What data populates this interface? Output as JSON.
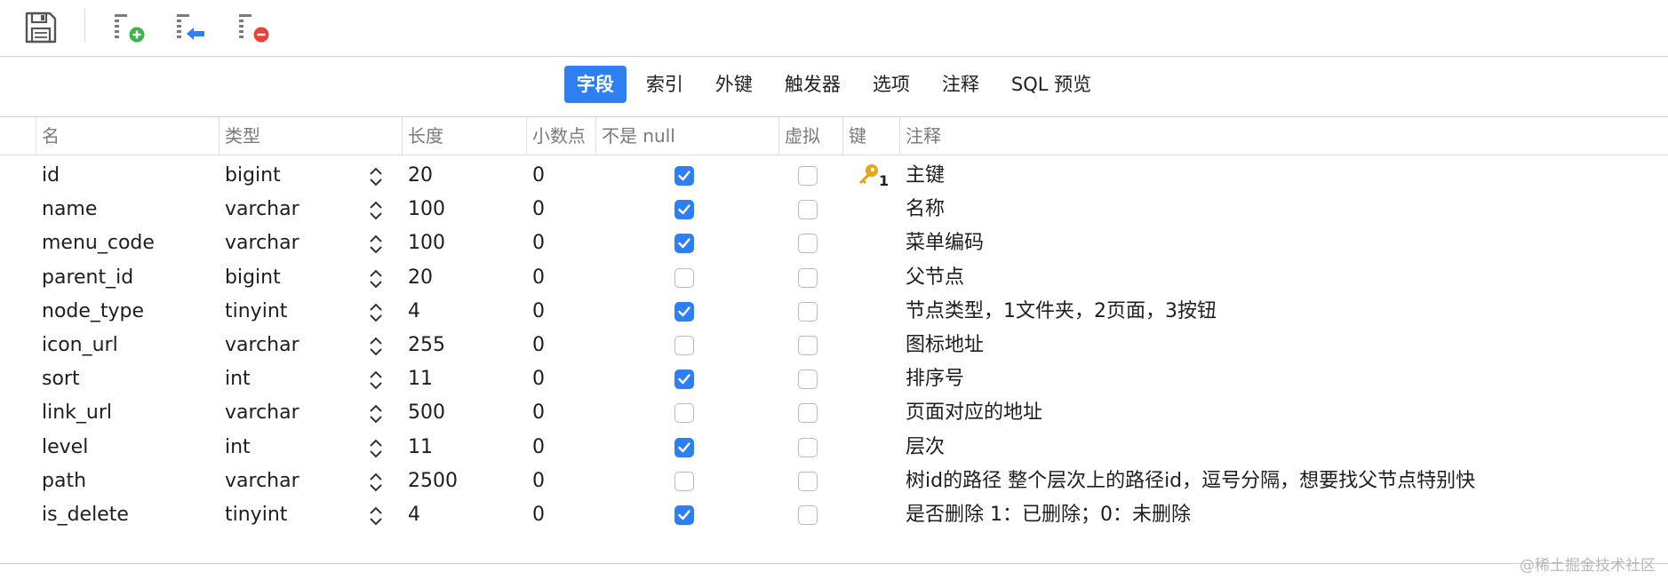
{
  "toolbar": {
    "buttons": [
      {
        "name": "save",
        "icon": "floppy-disk-icon"
      },
      {
        "name": "add-field",
        "icon": "add-field-icon"
      },
      {
        "name": "insert-field",
        "icon": "insert-field-icon"
      },
      {
        "name": "delete-field",
        "icon": "delete-field-icon"
      }
    ]
  },
  "tabs": [
    {
      "label": "字段",
      "active": true
    },
    {
      "label": "索引",
      "active": false
    },
    {
      "label": "外键",
      "active": false
    },
    {
      "label": "触发器",
      "active": false
    },
    {
      "label": "选项",
      "active": false
    },
    {
      "label": "注释",
      "active": false
    },
    {
      "label": "SQL 预览",
      "active": false
    }
  ],
  "columns": [
    "名",
    "类型",
    "长度",
    "小数点",
    "不是 null",
    "虚拟",
    "键",
    "注释"
  ],
  "rows": [
    {
      "name": "id",
      "type": "bigint",
      "length": "20",
      "decimals": "0",
      "not_null": true,
      "virtual": false,
      "key": "1",
      "comment": "主键"
    },
    {
      "name": "name",
      "type": "varchar",
      "length": "100",
      "decimals": "0",
      "not_null": true,
      "virtual": false,
      "key": "",
      "comment": "名称"
    },
    {
      "name": "menu_code",
      "type": "varchar",
      "length": "100",
      "decimals": "0",
      "not_null": true,
      "virtual": false,
      "key": "",
      "comment": "菜单编码"
    },
    {
      "name": "parent_id",
      "type": "bigint",
      "length": "20",
      "decimals": "0",
      "not_null": false,
      "virtual": false,
      "key": "",
      "comment": "父节点"
    },
    {
      "name": "node_type",
      "type": "tinyint",
      "length": "4",
      "decimals": "0",
      "not_null": true,
      "virtual": false,
      "key": "",
      "comment": "节点类型，1文件夹，2页面，3按钮"
    },
    {
      "name": "icon_url",
      "type": "varchar",
      "length": "255",
      "decimals": "0",
      "not_null": false,
      "virtual": false,
      "key": "",
      "comment": "图标地址"
    },
    {
      "name": "sort",
      "type": "int",
      "length": "11",
      "decimals": "0",
      "not_null": true,
      "virtual": false,
      "key": "",
      "comment": "排序号"
    },
    {
      "name": "link_url",
      "type": "varchar",
      "length": "500",
      "decimals": "0",
      "not_null": false,
      "virtual": false,
      "key": "",
      "comment": "页面对应的地址"
    },
    {
      "name": "level",
      "type": "int",
      "length": "11",
      "decimals": "0",
      "not_null": true,
      "virtual": false,
      "key": "",
      "comment": "层次"
    },
    {
      "name": "path",
      "type": "varchar",
      "length": "2500",
      "decimals": "0",
      "not_null": false,
      "virtual": false,
      "key": "",
      "comment": "树id的路径 整个层次上的路径id，逗号分隔，想要找父节点特别快"
    },
    {
      "name": "is_delete",
      "type": "tinyint",
      "length": "4",
      "decimals": "0",
      "not_null": true,
      "virtual": false,
      "key": "",
      "comment": "是否删除 1：已删除；0：未删除"
    }
  ],
  "watermark": "@稀土掘金技术社区",
  "colors": {
    "accent": "#2d7ff2",
    "key_icon": "#e8a317",
    "add_icon": "#3ab54a",
    "delete_icon": "#e5433b",
    "arrow_icon": "#2d7ff2"
  }
}
